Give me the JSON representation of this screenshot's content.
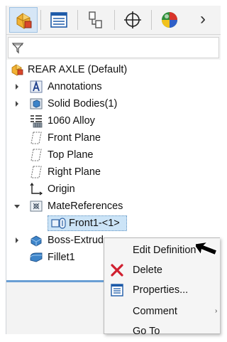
{
  "tabs": [
    {
      "name": "tab-featuremanager",
      "icon": "featuremanager-icon"
    },
    {
      "name": "tab-propertymanager",
      "icon": "propertymanager-icon"
    },
    {
      "name": "tab-configurationmanager",
      "icon": "configurationmanager-icon"
    },
    {
      "name": "tab-dimxpertmanager",
      "icon": "dimxpert-icon"
    },
    {
      "name": "tab-displaymanager",
      "icon": "displaymanager-icon"
    }
  ],
  "more_tabs_glyph": "›",
  "filter": {
    "icon": "filter-icon",
    "value": ""
  },
  "tree": {
    "root": "REAR AXLE (Default)",
    "items": [
      {
        "label": "Annotations",
        "icon": "annotations-icon",
        "expandable": true
      },
      {
        "label": "Solid Bodies(1)",
        "icon": "solid-bodies-icon",
        "expandable": true
      },
      {
        "label": "1060 Alloy",
        "icon": "material-icon",
        "expandable": false
      },
      {
        "label": "Front Plane",
        "icon": "plane-icon",
        "expandable": false
      },
      {
        "label": "Top Plane",
        "icon": "plane-icon",
        "expandable": false
      },
      {
        "label": "Right Plane",
        "icon": "plane-icon",
        "expandable": false
      },
      {
        "label": "Origin",
        "icon": "origin-icon",
        "expandable": false
      },
      {
        "label": "MateReferences",
        "icon": "matereferences-icon",
        "expanded": true
      },
      {
        "label": "Front1-<1>",
        "icon": "mate-reference-icon",
        "selected": true
      },
      {
        "label": "Boss-Extrud",
        "icon": "boss-extrude-icon",
        "expandable": true
      },
      {
        "label": "Fillet1",
        "icon": "fillet-icon",
        "expandable": false
      }
    ]
  },
  "context_menu": {
    "items": [
      {
        "label": "Edit Definition",
        "icon": "",
        "bold": true
      },
      {
        "label": "Delete",
        "icon": "delete-icon"
      },
      {
        "label": "Properties...",
        "icon": "properties-icon"
      },
      {
        "label": "Comment",
        "icon": "",
        "submenu": true,
        "submenu_glyph": "›"
      },
      {
        "label": "Go To",
        "icon": ""
      }
    ]
  },
  "colors": {
    "accent": "#6a9fd4",
    "selection": "#cce4f7",
    "delete_red": "#d01f2f",
    "panel_bg": "#f3f3f3"
  }
}
